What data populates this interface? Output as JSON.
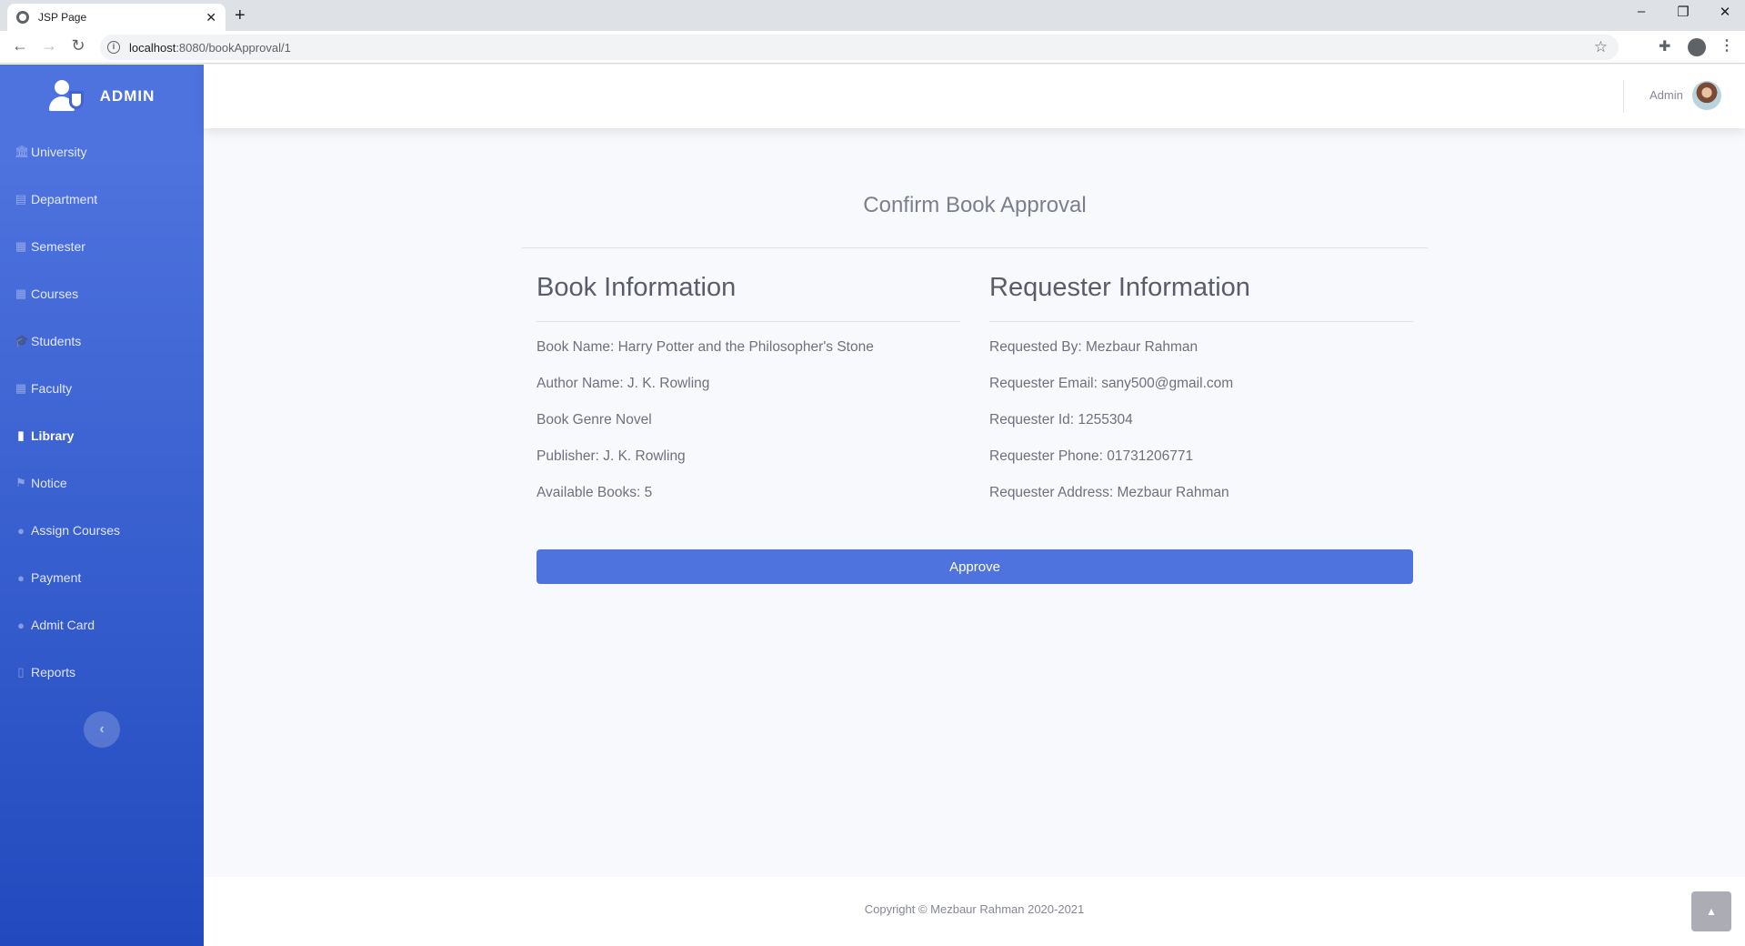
{
  "browser": {
    "tab_title": "JSP Page",
    "url_host": "localhost",
    "url_path": ":8080/bookApproval/1"
  },
  "sidebar": {
    "brand": "ADMIN",
    "items": [
      {
        "label": "University",
        "icon": "university-icon"
      },
      {
        "label": "Department",
        "icon": "id-card-icon"
      },
      {
        "label": "Semester",
        "icon": "table-icon"
      },
      {
        "label": "Courses",
        "icon": "table-icon"
      },
      {
        "label": "Students",
        "icon": "graduation-cap-icon"
      },
      {
        "label": "Faculty",
        "icon": "table-icon"
      },
      {
        "label": "Library",
        "icon": "book-icon",
        "active": true
      },
      {
        "label": "Notice",
        "icon": "flag-icon"
      },
      {
        "label": "Assign Courses",
        "icon": "circle-icon"
      },
      {
        "label": "Payment",
        "icon": "circle-icon"
      },
      {
        "label": "Admit Card",
        "icon": "circle-icon"
      },
      {
        "label": "Reports",
        "icon": "file-icon"
      }
    ]
  },
  "topbar": {
    "user_name": "Admin"
  },
  "main": {
    "title": "Confirm Book Approval",
    "book": {
      "heading": "Book Information",
      "name": "Book Name: Harry Potter and the Philosopher's Stone",
      "author": "Author Name: J. K. Rowling",
      "genre": "Book Genre Novel",
      "publisher": "Publisher: J. K. Rowling",
      "available": "Available Books: 5"
    },
    "requester": {
      "heading": "Requester Information",
      "by": "Requested By: Mezbaur Rahman",
      "email": "Requester Email: sany500@gmail.com",
      "id": "Requester Id: 1255304",
      "phone": "Requester Phone: 01731206771",
      "address": "Requester Address: Mezbaur Rahman"
    },
    "approve_label": "Approve"
  },
  "footer": {
    "copyright": "Copyright © Mezbaur Rahman 2020-2021"
  },
  "colors": {
    "primary": "#4e73df",
    "sidebar_bottom": "#224abe",
    "background": "#f8f9fc"
  }
}
